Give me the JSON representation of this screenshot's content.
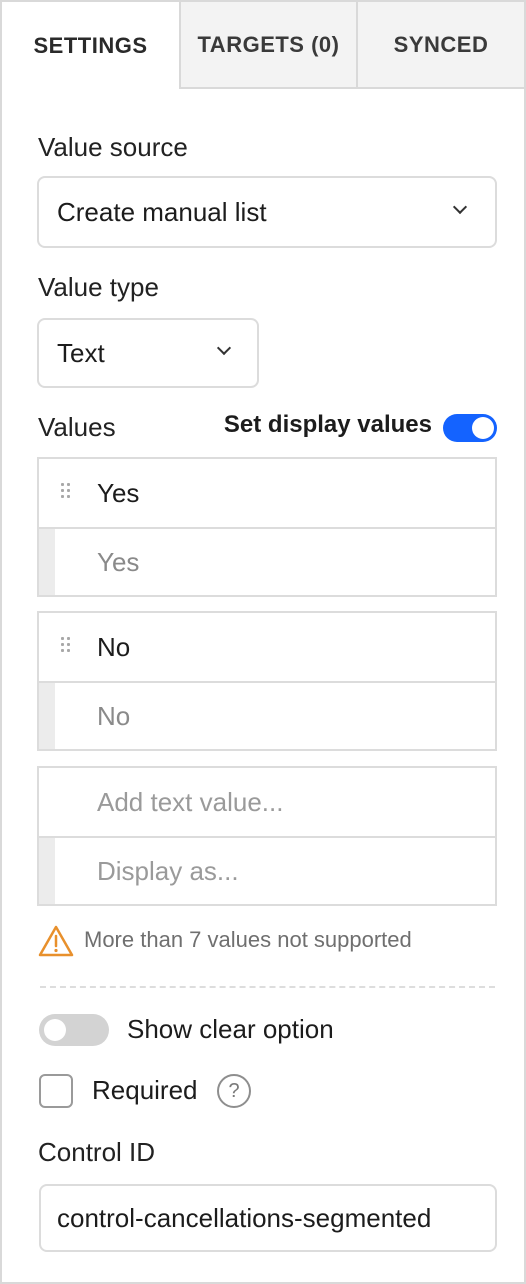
{
  "tabs": [
    {
      "label": "SETTINGS",
      "active": true
    },
    {
      "label": "TARGETS (0)",
      "active": false
    },
    {
      "label": "SYNCED",
      "active": false
    }
  ],
  "value_source": {
    "label": "Value source",
    "selected": "Create manual list"
  },
  "value_type": {
    "label": "Value type",
    "selected": "Text"
  },
  "values": {
    "label": "Values",
    "display_toggle_label": "Set display values",
    "display_toggle_on": true,
    "items": [
      {
        "value": "Yes",
        "display": "Yes"
      },
      {
        "value": "No",
        "display": "No"
      }
    ],
    "new_item": {
      "value_placeholder": "Add text value...",
      "display_placeholder": "Display as..."
    }
  },
  "warning": {
    "text": "More than 7 values not supported",
    "color": "#e8902c"
  },
  "show_clear": {
    "label": "Show clear option",
    "on": false
  },
  "required": {
    "label": "Required",
    "checked": false,
    "help_glyph": "?"
  },
  "control_id": {
    "label": "Control ID",
    "value": "control-cancellations-segmented"
  },
  "colors": {
    "accent": "#1463ff",
    "warning": "#e8902c"
  },
  "icons": [
    "chevron-down-icon",
    "drag-handle-icon",
    "warning-icon",
    "help-icon"
  ]
}
